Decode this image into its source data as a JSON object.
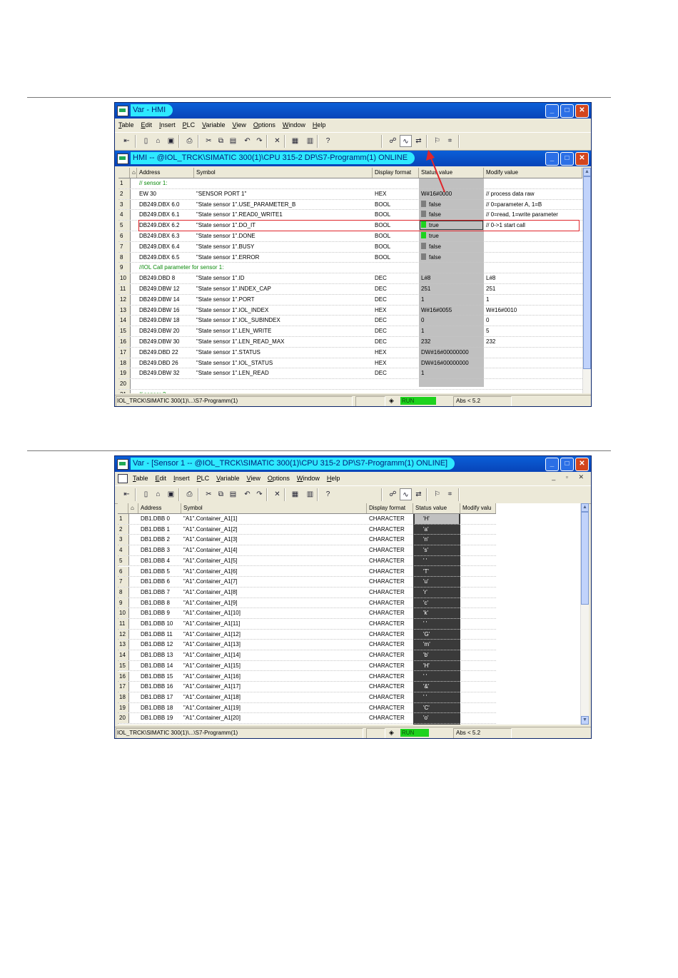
{
  "window1": {
    "title": "Var - HMI",
    "menu": [
      "Table",
      "Edit",
      "Insert",
      "PLC",
      "Variable",
      "View",
      "Options",
      "Window",
      "Help"
    ],
    "child_title": "HMI -- @IOL_TRCK\\SIMATIC 300(1)\\CPU 315-2 DP\\S7-Programm(1)  ONLINE",
    "headers": {
      "address": "Address",
      "symbol": "Symbol",
      "format": "Display format",
      "status": "Status value",
      "modify": "Modify value"
    },
    "rows": [
      {
        "n": "1",
        "comment": "// sensor 1:"
      },
      {
        "n": "2",
        "address": "EW   30",
        "symbol": "\"SENSOR PORT 1\"",
        "format": "HEX",
        "status": "W#16#0000",
        "modify": "// process data raw"
      },
      {
        "n": "3",
        "address": "DB249.DBX   6.0",
        "symbol": "\"State sensor 1\".USE_PARAMETER_B",
        "format": "BOOL",
        "status": "false",
        "lamp": "gray",
        "modify": "// 0=parameter A, 1=B"
      },
      {
        "n": "4",
        "address": "DB249.DBX   6.1",
        "symbol": "\"State sensor 1\".READ0_WRITE1",
        "format": "BOOL",
        "status": "false",
        "lamp": "gray",
        "modify": "// 0=read, 1=write parameter"
      },
      {
        "n": "5",
        "address": "DB249.DBX   6.2",
        "symbol": "\"State sensor 1\".DO_IT",
        "format": "BOOL",
        "status": "true",
        "lamp": "green",
        "modify": "// 0->1 start call"
      },
      {
        "n": "6",
        "address": "DB249.DBX   6.3",
        "symbol": "\"State sensor 1\".DONE",
        "format": "BOOL",
        "status": "true",
        "lamp": "green",
        "modify": ""
      },
      {
        "n": "7",
        "address": "DB249.DBX   6.4",
        "symbol": "\"State sensor 1\".BUSY",
        "format": "BOOL",
        "status": "false",
        "lamp": "gray",
        "modify": ""
      },
      {
        "n": "8",
        "address": "DB249.DBX   6.5",
        "symbol": "\"State sensor 1\".ERROR",
        "format": "BOOL",
        "status": "false",
        "lamp": "gray",
        "modify": ""
      },
      {
        "n": "9",
        "comment": "//IOL Call parameter for sensor 1:"
      },
      {
        "n": "10",
        "address": "DB249.DBD   8",
        "symbol": "\"State sensor 1\".ID",
        "format": "DEC",
        "status": "L#8",
        "modify": "L#8"
      },
      {
        "n": "11",
        "address": "DB249.DBW   12",
        "symbol": "\"State sensor 1\".INDEX_CAP",
        "format": "DEC",
        "status": "251",
        "modify": "251"
      },
      {
        "n": "12",
        "address": "DB249.DBW   14",
        "symbol": "\"State sensor 1\".PORT",
        "format": "DEC",
        "status": "1",
        "modify": "1"
      },
      {
        "n": "13",
        "address": "DB249.DBW   16",
        "symbol": "\"State sensor 1\".IOL_INDEX",
        "format": "HEX",
        "status": "W#16#0055",
        "modify": "W#16#0010"
      },
      {
        "n": "14",
        "address": "DB249.DBW   18",
        "symbol": "\"State sensor 1\".IOL_SUBINDEX",
        "format": "DEC",
        "status": "0",
        "modify": "0"
      },
      {
        "n": "15",
        "address": "DB249.DBW   20",
        "symbol": "\"State sensor 1\".LEN_WRITE",
        "format": "DEC",
        "status": "1",
        "modify": "5"
      },
      {
        "n": "16",
        "address": "DB249.DBW   30",
        "symbol": "\"State sensor 1\".LEN_READ_MAX",
        "format": "DEC",
        "status": "232",
        "modify": "232"
      },
      {
        "n": "17",
        "address": "DB249.DBD   22",
        "symbol": "\"State sensor 1\".STATUS",
        "format": "HEX",
        "status": "DW#16#00000000",
        "modify": ""
      },
      {
        "n": "18",
        "address": "DB249.DBD   26",
        "symbol": "\"State sensor 1\".IOL_STATUS",
        "format": "HEX",
        "status": "DW#16#00000000",
        "modify": ""
      },
      {
        "n": "19",
        "address": "DB249.DBW   32",
        "symbol": "\"State sensor 1\".LEN_READ",
        "format": "DEC",
        "status": "1",
        "modify": ""
      },
      {
        "n": "20"
      },
      {
        "n": "21",
        "comment": "// sensor 2"
      }
    ],
    "statusbar": {
      "path": "IOL_TRCK\\SIMATIC 300(1)\\...\\S7-Programm(1)",
      "run": "RUN",
      "abs": "Abs < 5.2"
    }
  },
  "window2": {
    "title": "Var - [Sensor 1 -- @IOL_TRCK\\SIMATIC 300(1)\\CPU 315-2 DP\\S7-Programm(1)  ONLINE]",
    "menu": [
      "Table",
      "Edit",
      "Insert",
      "PLC",
      "Variable",
      "View",
      "Options",
      "Window",
      "Help"
    ],
    "headers": {
      "address": "Address",
      "symbol": "Symbol",
      "format": "Display format",
      "status": "Status value",
      "modify": "Modify valu"
    },
    "rows": [
      {
        "n": "1",
        "address": "DB1.DBB   0",
        "symbol": "\"A1\".Container_A1[1]",
        "format": "CHARACTER",
        "status": "'H'"
      },
      {
        "n": "2",
        "address": "DB1.DBB   1",
        "symbol": "\"A1\".Container_A1[2]",
        "format": "CHARACTER",
        "status": "'a'"
      },
      {
        "n": "3",
        "address": "DB1.DBB   2",
        "symbol": "\"A1\".Container_A1[3]",
        "format": "CHARACTER",
        "status": "'n'"
      },
      {
        "n": "4",
        "address": "DB1.DBB   3",
        "symbol": "\"A1\".Container_A1[4]",
        "format": "CHARACTER",
        "status": "'s'"
      },
      {
        "n": "5",
        "address": "DB1.DBB   4",
        "symbol": "\"A1\".Container_A1[5]",
        "format": "CHARACTER",
        "status": "' '"
      },
      {
        "n": "6",
        "address": "DB1.DBB   5",
        "symbol": "\"A1\".Container_A1[6]",
        "format": "CHARACTER",
        "status": "'T'"
      },
      {
        "n": "7",
        "address": "DB1.DBB   6",
        "symbol": "\"A1\".Container_A1[7]",
        "format": "CHARACTER",
        "status": "'u'"
      },
      {
        "n": "8",
        "address": "DB1.DBB   7",
        "symbol": "\"A1\".Container_A1[8]",
        "format": "CHARACTER",
        "status": "'r'"
      },
      {
        "n": "9",
        "address": "DB1.DBB   8",
        "symbol": "\"A1\".Container_A1[9]",
        "format": "CHARACTER",
        "status": "'c'"
      },
      {
        "n": "10",
        "address": "DB1.DBB   9",
        "symbol": "\"A1\".Container_A1[10]",
        "format": "CHARACTER",
        "status": "'k'"
      },
      {
        "n": "11",
        "address": "DB1.DBB   10",
        "symbol": "\"A1\".Container_A1[11]",
        "format": "CHARACTER",
        "status": "' '"
      },
      {
        "n": "12",
        "address": "DB1.DBB   11",
        "symbol": "\"A1\".Container_A1[12]",
        "format": "CHARACTER",
        "status": "'G'"
      },
      {
        "n": "13",
        "address": "DB1.DBB   12",
        "symbol": "\"A1\".Container_A1[13]",
        "format": "CHARACTER",
        "status": "'m'"
      },
      {
        "n": "14",
        "address": "DB1.DBB   13",
        "symbol": "\"A1\".Container_A1[14]",
        "format": "CHARACTER",
        "status": "'b'"
      },
      {
        "n": "15",
        "address": "DB1.DBB   14",
        "symbol": "\"A1\".Container_A1[15]",
        "format": "CHARACTER",
        "status": "'H'"
      },
      {
        "n": "16",
        "address": "DB1.DBB   15",
        "symbol": "\"A1\".Container_A1[16]",
        "format": "CHARACTER",
        "status": "' '"
      },
      {
        "n": "17",
        "address": "DB1.DBB   16",
        "symbol": "\"A1\".Container_A1[17]",
        "format": "CHARACTER",
        "status": "'&'"
      },
      {
        "n": "18",
        "address": "DB1.DBB   17",
        "symbol": "\"A1\".Container_A1[18]",
        "format": "CHARACTER",
        "status": "' '"
      },
      {
        "n": "19",
        "address": "DB1.DBB   18",
        "symbol": "\"A1\".Container_A1[19]",
        "format": "CHARACTER",
        "status": "'C'"
      },
      {
        "n": "20",
        "address": "DB1.DBB   19",
        "symbol": "\"A1\".Container_A1[20]",
        "format": "CHARACTER",
        "status": "'o'"
      }
    ],
    "statusbar": {
      "path": "IOL_TRCK\\SIMATIC 300(1)\\...\\S7-Programm(1)",
      "run": "RUN",
      "abs": "Abs < 5.2"
    }
  },
  "colors": {
    "titlebar": "#0a5fd8",
    "title_highlight": "#2ee9ff",
    "run_green": "#1ed31e",
    "highlight_box": "#e0262b",
    "annotation_arrow": "#e0262b",
    "status_col_dark": "#3a3a3a",
    "status_col_light": "#c0c0c0"
  },
  "icons": [
    "insert-row-icon",
    "new-icon",
    "open-icon",
    "save-icon",
    "print-icon",
    "cut-icon",
    "copy-icon",
    "paste-icon",
    "undo-icon",
    "redo-icon",
    "delete-icon",
    "monitor-icon",
    "modify-icon",
    "help-icon",
    "watch-icon",
    "glasses-icon",
    "trigger-icon",
    "force-icon",
    "tag-icon"
  ]
}
